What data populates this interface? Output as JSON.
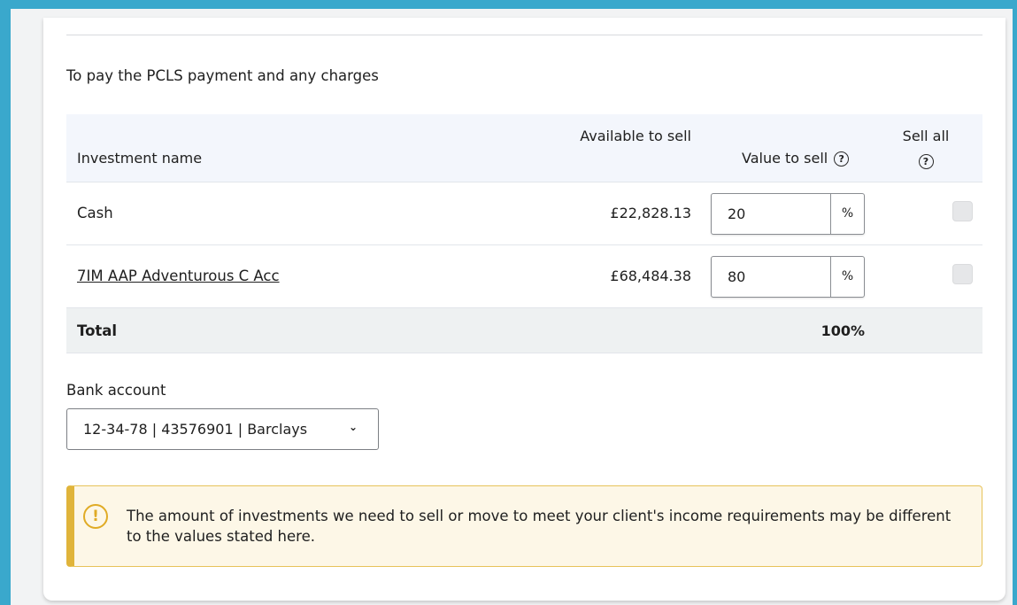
{
  "intro_text": "To pay the PCLS payment and any charges",
  "table": {
    "headers": {
      "name": "Investment name",
      "available": "Available to sell",
      "value": "Value to sell",
      "sell_all": "Sell all"
    },
    "help_glyph": "?",
    "rows": [
      {
        "name": "Cash",
        "available": "£22,828.13",
        "value": "20",
        "unit": "%",
        "sell_all": false,
        "is_link": false
      },
      {
        "name": "7IM AAP Adventurous C Acc",
        "available": "£68,484.38",
        "value": "80",
        "unit": "%",
        "sell_all": false,
        "is_link": true
      }
    ],
    "total_label": "Total",
    "total_value": "100%"
  },
  "bank": {
    "label": "Bank account",
    "selected": "12-34-78 | 43576901 | Barclays",
    "chevron_glyph": "⌄"
  },
  "alert": {
    "icon_glyph": "!",
    "text": "The amount of investments we need to sell or move to meet your client's income requirements may be different to the values stated here."
  },
  "colors": {
    "outer_border": "#3aa8cc",
    "header_bg": "#f3f6fc",
    "total_bg": "#eef1f2",
    "alert_bg": "#fdf7e7",
    "alert_accent": "#e0b43a"
  },
  "icons": [
    "help-icon",
    "chevron-down-icon",
    "warning-icon"
  ]
}
